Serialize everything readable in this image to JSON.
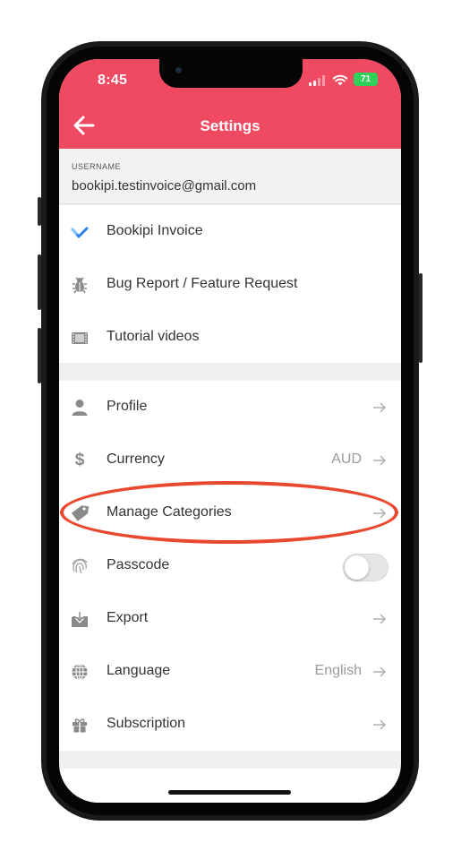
{
  "status_bar": {
    "time": "8:45",
    "battery": "71"
  },
  "app_bar": {
    "title": "Settings",
    "back_icon": "arrow-left-icon"
  },
  "user": {
    "label": "USERNAME",
    "email": "bookipi.testinvoice@gmail.com"
  },
  "support_items": [
    {
      "label": "Bookipi Invoice",
      "icon": "bookipi-logo-icon"
    },
    {
      "label": "Bug Report / Feature Request",
      "icon": "bug-icon"
    },
    {
      "label": "Tutorial videos",
      "icon": "film-icon"
    }
  ],
  "settings_items": [
    {
      "label": "Profile",
      "icon": "person-icon",
      "value": ""
    },
    {
      "label": "Currency",
      "icon": "dollar-icon",
      "value": "AUD"
    },
    {
      "label": "Manage Categories",
      "icon": "tag-icon",
      "value": ""
    },
    {
      "label": "Passcode",
      "icon": "fingerprint-icon",
      "toggle": false
    },
    {
      "label": "Export",
      "icon": "export-icon",
      "value": ""
    },
    {
      "label": "Language",
      "icon": "globe-icon",
      "value": "English"
    },
    {
      "label": "Subscription",
      "icon": "gift-icon",
      "value": ""
    }
  ],
  "colors": {
    "accent": "#f04a63",
    "annotation": "#e8482e",
    "logo_blue": "#2f80ed"
  },
  "annotation": {
    "target": "Manage Categories"
  }
}
